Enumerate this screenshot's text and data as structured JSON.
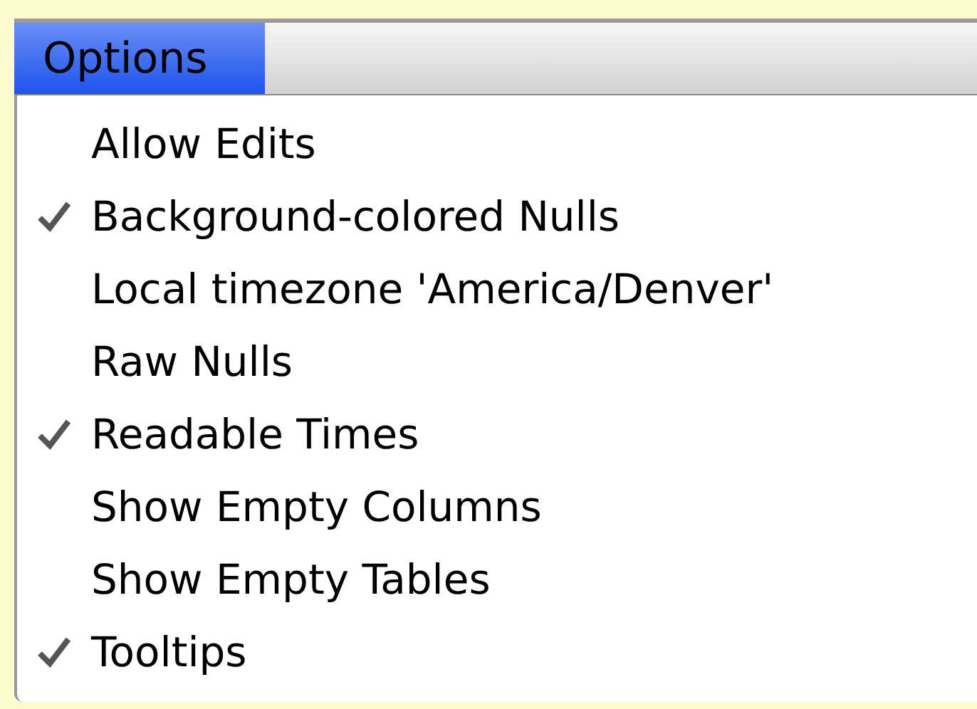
{
  "menu_bar": {
    "title": "Options",
    "selected": true
  },
  "menu": {
    "items": [
      {
        "label": "Allow Edits",
        "checked": false
      },
      {
        "label": "Background-colored Nulls",
        "checked": true
      },
      {
        "label": "Local timezone 'America/Denver'",
        "checked": false
      },
      {
        "label": "Raw Nulls",
        "checked": false
      },
      {
        "label": "Readable Times",
        "checked": true
      },
      {
        "label": "Show Empty Columns",
        "checked": false
      },
      {
        "label": "Show Empty Tables",
        "checked": false
      },
      {
        "label": "Tooltips",
        "checked": true
      }
    ]
  }
}
